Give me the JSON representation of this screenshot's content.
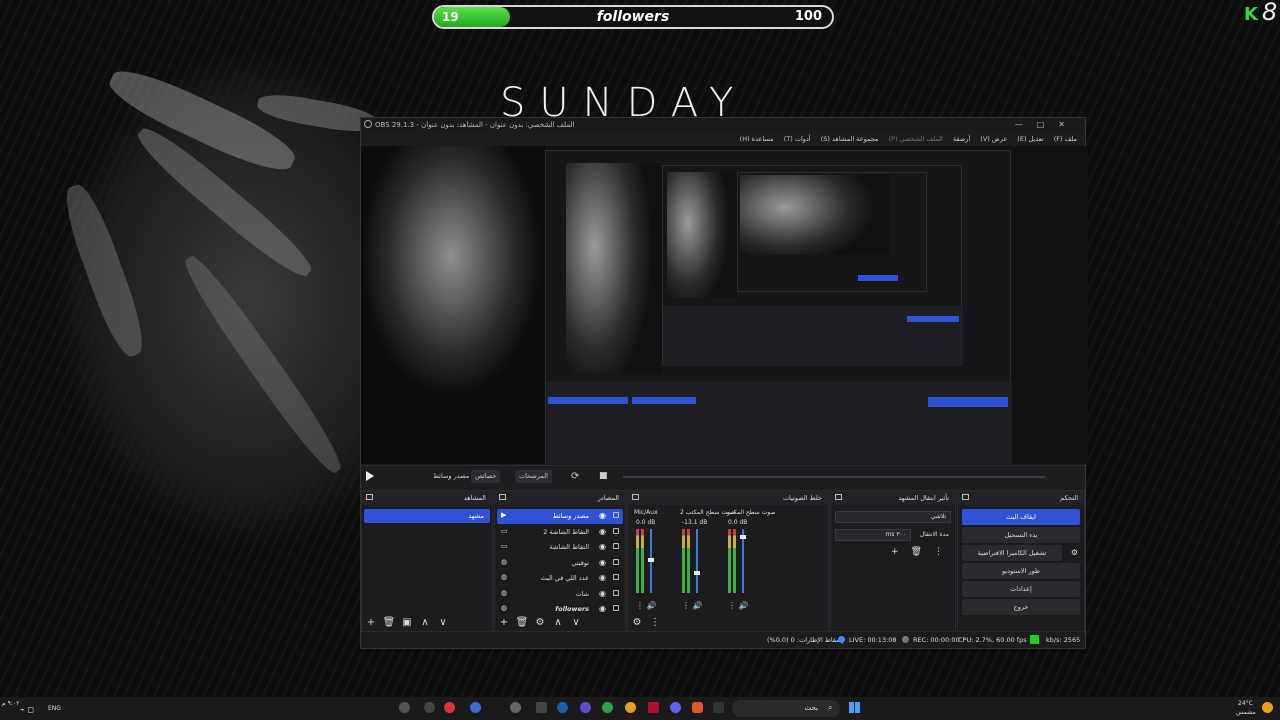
{
  "overlay": {
    "followers_current": "19",
    "followers_label": "followers",
    "followers_goal": "100",
    "followers_fraction": 0.19,
    "brand_text": "SUNDAY",
    "kick_logo": "K",
    "kick_badge": "8",
    "accent_green": "#3cd33c"
  },
  "obs": {
    "title": "OBS 29.1.3 - الملف الشخصي: بدون عنوان - المشاهد: بدون عنوان",
    "window_buttons": [
      "—",
      "□",
      "✕"
    ],
    "menu": [
      "ملف (F)",
      "تعديل (E)",
      "عرض (V)",
      "أرصفة",
      "الملف الشخصي (P)",
      "مجموعة المشاهد (S)",
      "أدوات (T)",
      "مساعدة (H)"
    ],
    "transport": {
      "source_name": "مصدر وسائط",
      "properties": "خصائص",
      "filters": "المرشحات",
      "refresh_icon": "⟳",
      "stop_icon": "■"
    },
    "scenes": {
      "title": "المشاهد",
      "items": [
        "مشهد"
      ],
      "footer": [
        "+",
        "🗑",
        "▣",
        "∧",
        "∨"
      ]
    },
    "sources": {
      "title": "المصادر",
      "items": [
        {
          "label": "مصدر وسائط",
          "icon": "play-icon",
          "selected": true
        },
        {
          "label": "التقاط الشاشة 2",
          "icon": "monitor-icon",
          "selected": false
        },
        {
          "label": "التقاط الشاشة",
          "icon": "monitor-icon",
          "selected": false
        },
        {
          "label": "توقيتي",
          "icon": "globe-icon",
          "selected": false
        },
        {
          "label": "عدد اللي في البث",
          "icon": "globe-icon",
          "selected": false
        },
        {
          "label": "شات",
          "icon": "globe-icon",
          "selected": false
        },
        {
          "label": "followers",
          "icon": "globe-icon",
          "selected": false
        }
      ],
      "footer": [
        "+",
        "🗑",
        "⚙",
        "∧",
        "∨"
      ]
    },
    "mixer": {
      "title": "خلط الصوتيات",
      "channels": [
        {
          "name": "Mic/Aux",
          "db": "0.0 dB",
          "level": 0.55
        },
        {
          "name": "صوت سطح المكتب 2",
          "db": "-13.1 dB",
          "level": 0.35
        },
        {
          "name": "صوت سطح المكتب",
          "db": "0.0 dB",
          "level": 0.9
        }
      ],
      "footer": [
        "⚙",
        "⋮"
      ]
    },
    "transitions": {
      "title": "تأثير انتقال المشهد",
      "type": "تلاشي",
      "duration_label": "مدة الانتقال",
      "duration_value": "٣٠٠ ms",
      "icons": [
        "+",
        "🗑",
        "⋮"
      ]
    },
    "controls": {
      "title": "التحكم",
      "buttons": [
        "ايقاف البث",
        "بدء التسجيل",
        "تشغيل الكاميرا الافتراضية",
        "طور الاستوديو",
        "إعدادات",
        "خروج"
      ]
    },
    "status": {
      "dropped": "إسقاط الإطارات: 0 (0.0%)",
      "live": "LIVE: 00:13:08",
      "rec": "REC: 00:00:00",
      "cpu": "CPU: 2.7%, 60.00 fps",
      "kbps": "kb/s: 2565"
    }
  },
  "taskbar": {
    "search_placeholder": "بحث",
    "language": "ENG",
    "temperature": "24°C",
    "weather": "مشمس",
    "time": "٩:٠٢ م"
  }
}
